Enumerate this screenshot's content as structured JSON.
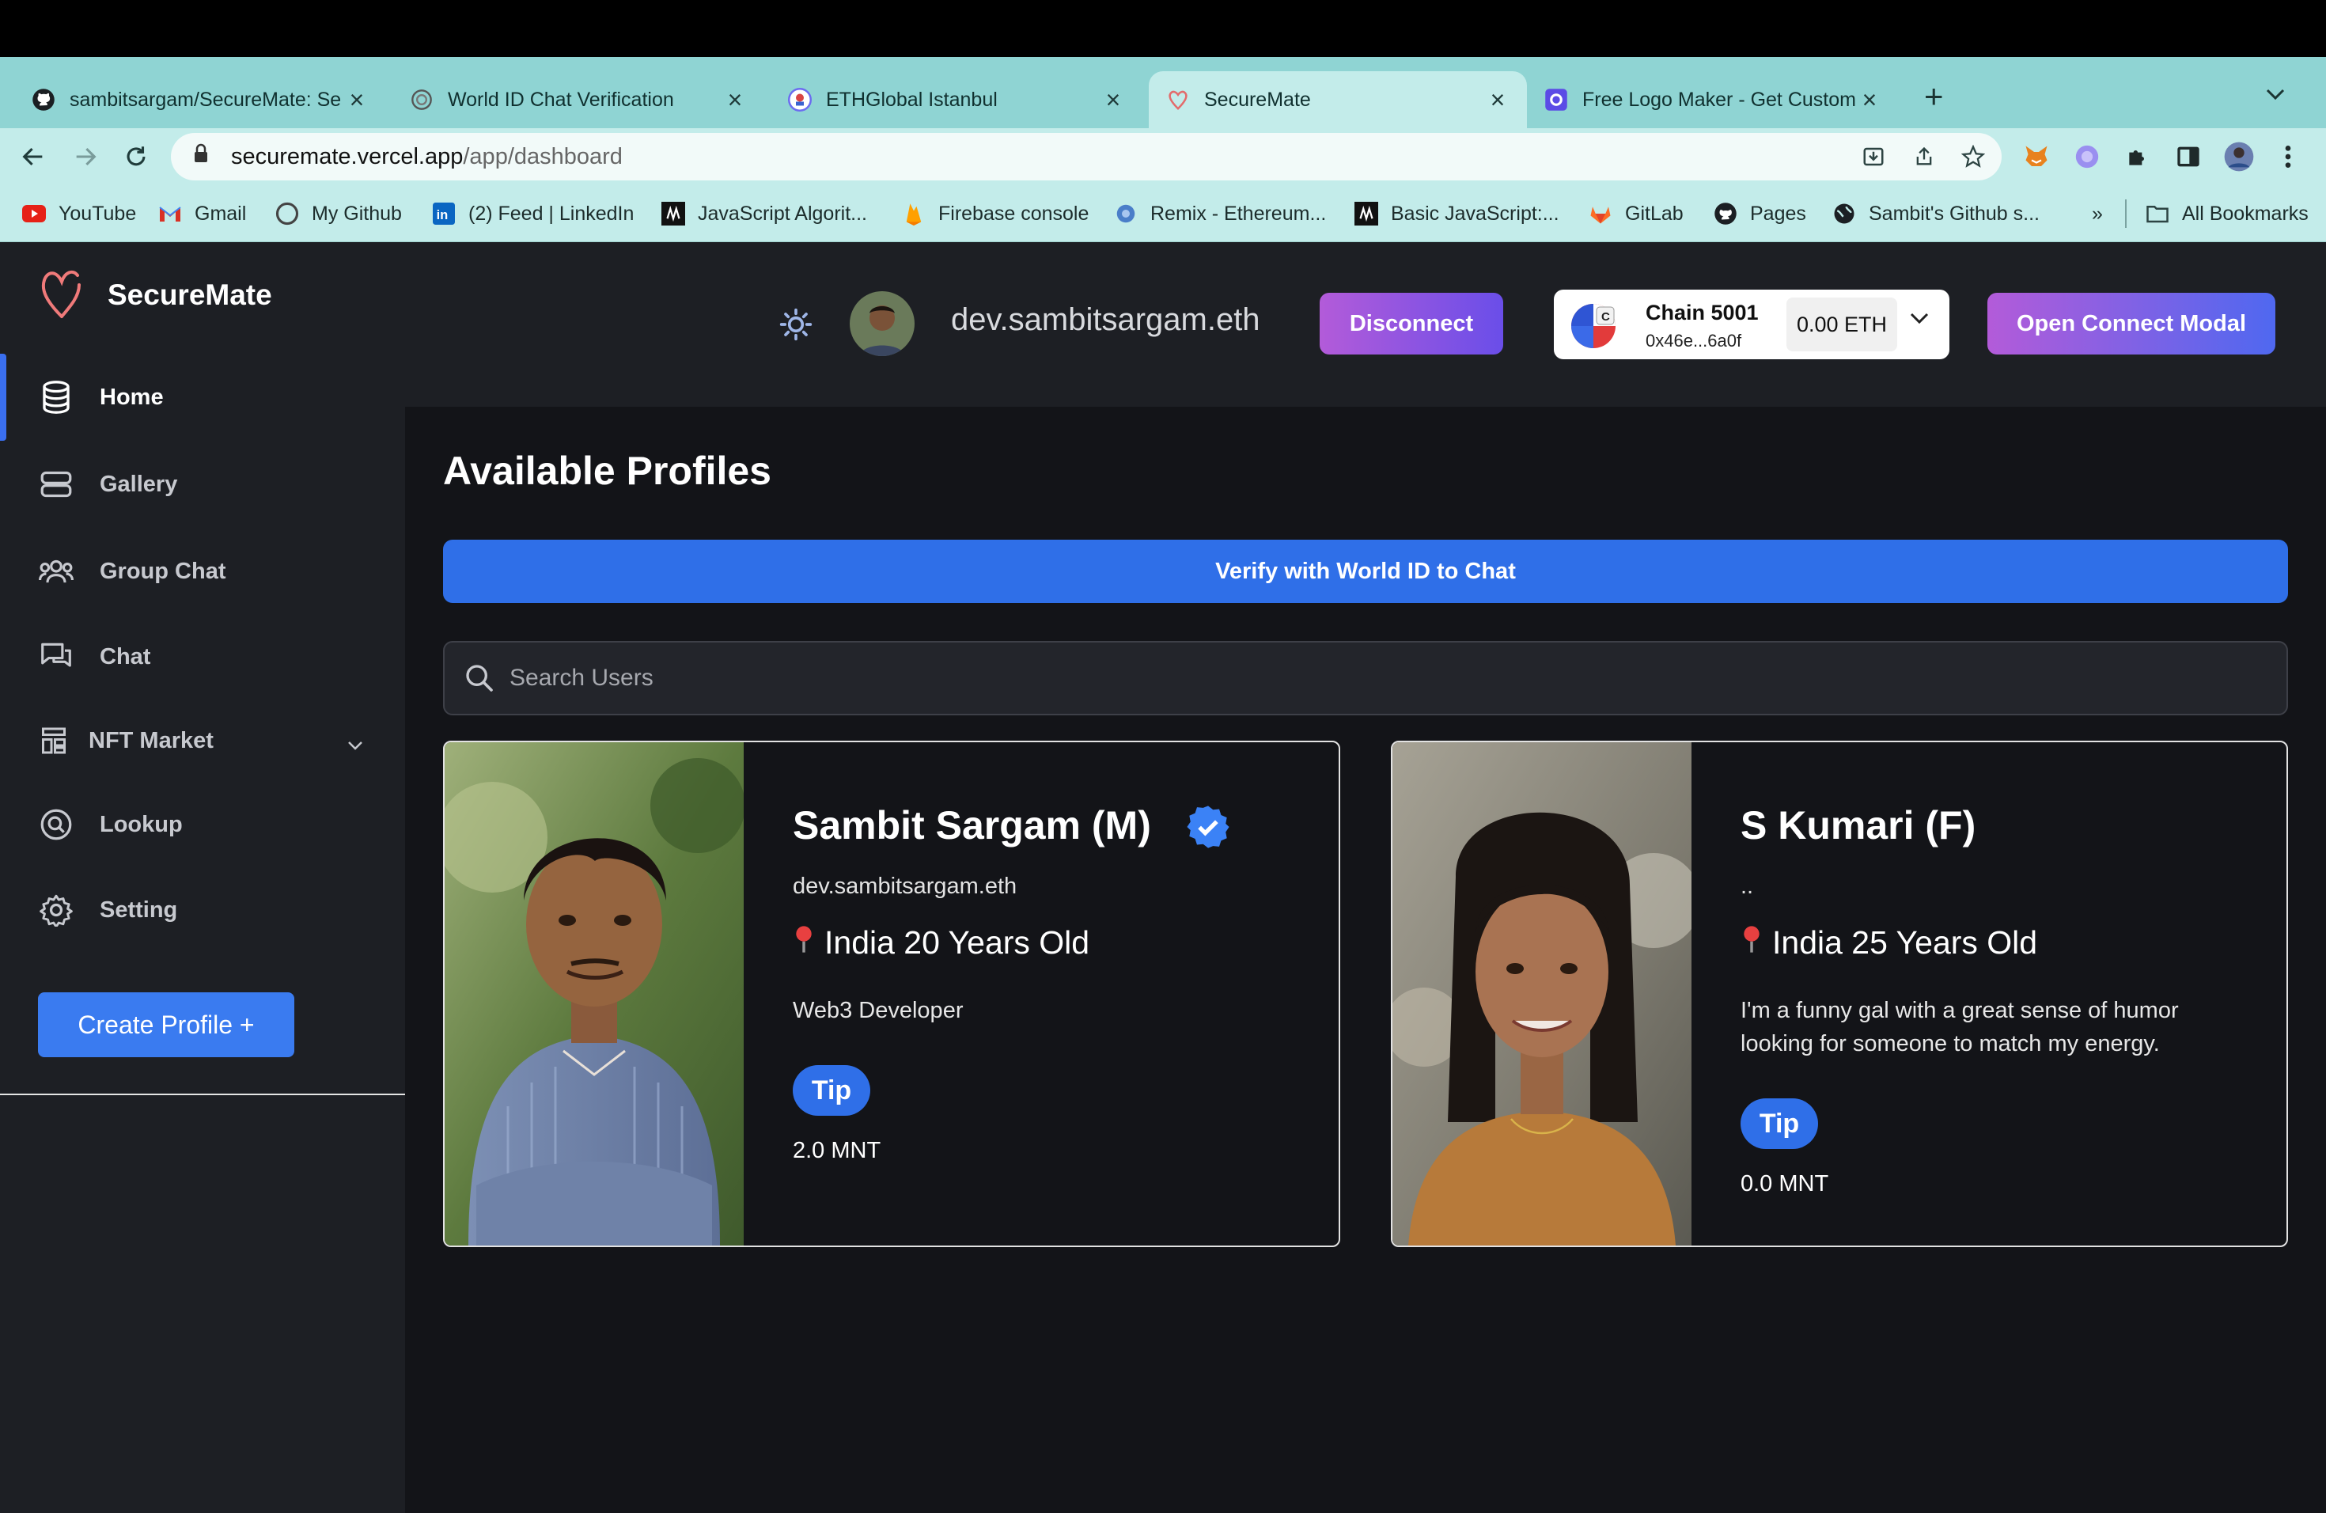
{
  "browser": {
    "tabs": [
      {
        "title": "sambitsargam/SecureMate: Se",
        "icon": "github-icon"
      },
      {
        "title": "World ID Chat Verification",
        "icon": "worldcoin-icon"
      },
      {
        "title": "ETHGlobal Istanbul",
        "icon": "ethglobal-icon"
      },
      {
        "title": "SecureMate",
        "icon": "heart-icon"
      },
      {
        "title": "Free Logo Maker - Get Custom",
        "icon": "logo-maker-icon"
      }
    ],
    "url_host": "securemate.vercel.app",
    "url_path": "/app/dashboard",
    "bookmarks": [
      {
        "label": "YouTube"
      },
      {
        "label": "Gmail"
      },
      {
        "label": "My Github"
      },
      {
        "label": "(2) Feed | LinkedIn"
      },
      {
        "label": "JavaScript Algorit..."
      },
      {
        "label": "Firebase console"
      },
      {
        "label": "Remix - Ethereum..."
      },
      {
        "label": "Basic JavaScript:..."
      },
      {
        "label": "GitLab"
      },
      {
        "label": "Pages"
      },
      {
        "label": "Sambit's Github s..."
      }
    ],
    "bookmarks_overflow": "»",
    "all_bookmarks": "All Bookmarks"
  },
  "app": {
    "brand": "SecureMate",
    "nav": [
      {
        "label": "Home",
        "icon": "database-icon"
      },
      {
        "label": "Gallery",
        "icon": "server-stack-icon"
      },
      {
        "label": "Group Chat",
        "icon": "users-icon"
      },
      {
        "label": "Chat",
        "icon": "chat-bubbles-icon"
      },
      {
        "label": "NFT Market",
        "icon": "market-icon"
      },
      {
        "label": "Lookup",
        "icon": "lookup-icon"
      },
      {
        "label": "Setting",
        "icon": "gear-icon"
      }
    ],
    "create_profile": "Create Profile  +",
    "header": {
      "ens": "dev.sambitsargam.eth",
      "disconnect": "Disconnect",
      "chain_name": "Chain 5001",
      "chain_badge": "C",
      "address": "0x46e...6a0f",
      "balance": "0.00 ETH",
      "open_modal": "Open Connect Modal"
    },
    "page_title": "Available Profiles",
    "verify_button": "Verify with World ID to Chat",
    "search_placeholder": "Search Users",
    "profiles": [
      {
        "name": "Sambit Sargam (M)",
        "verified": true,
        "handle": "dev.sambitsargam.eth",
        "location": "India 20 Years Old",
        "bio": "Web3 Developer",
        "tip_label": "Tip",
        "tip_amount": "2.0 MNT"
      },
      {
        "name": "S Kumari (F)",
        "verified": false,
        "handle": "..",
        "location": "India 25 Years Old",
        "bio": "I'm a funny gal with a great sense of humor looking for someone to match my energy.",
        "tip_label": "Tip",
        "tip_amount": "0.0 MNT"
      }
    ]
  },
  "colors": {
    "accent_blue": "#2f6fe8",
    "purple_gradient_start": "#b35bd9",
    "sidebar_bg": "#1d1f24",
    "main_bg": "#131418",
    "tab_strip": "#8fd4d3"
  }
}
